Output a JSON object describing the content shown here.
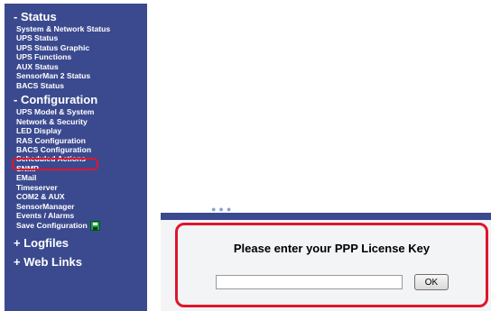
{
  "sidebar": {
    "status": {
      "header": "- Status",
      "items": [
        "System & Network Status",
        "UPS Status",
        "UPS Status Graphic",
        "UPS Functions",
        "AUX Status",
        "SensorMan 2 Status",
        "BACS Status"
      ]
    },
    "configuration": {
      "header": "- Configuration",
      "items": [
        "UPS Model & System",
        "Network & Security",
        "LED Display",
        "RAS Configuration",
        "BACS Configuration",
        "Scheduled Actions",
        "SNMP",
        "EMail",
        "Timeserver",
        "COM2 & AUX",
        "SensorManager",
        "Events / Alarms",
        "Save Configuration"
      ],
      "selected": "RAS Configuration"
    },
    "logfiles": {
      "header": "+ Logfiles"
    },
    "weblinks": {
      "header": "+ Web Links"
    }
  },
  "dialog": {
    "title": "Please enter your PPP License Key",
    "input_value": "",
    "ok_label": "OK"
  },
  "icons": {
    "save": "floppy-disk-icon"
  },
  "colors": {
    "sidebar_bg": "#3b4a8f",
    "highlight": "#e0162b"
  }
}
